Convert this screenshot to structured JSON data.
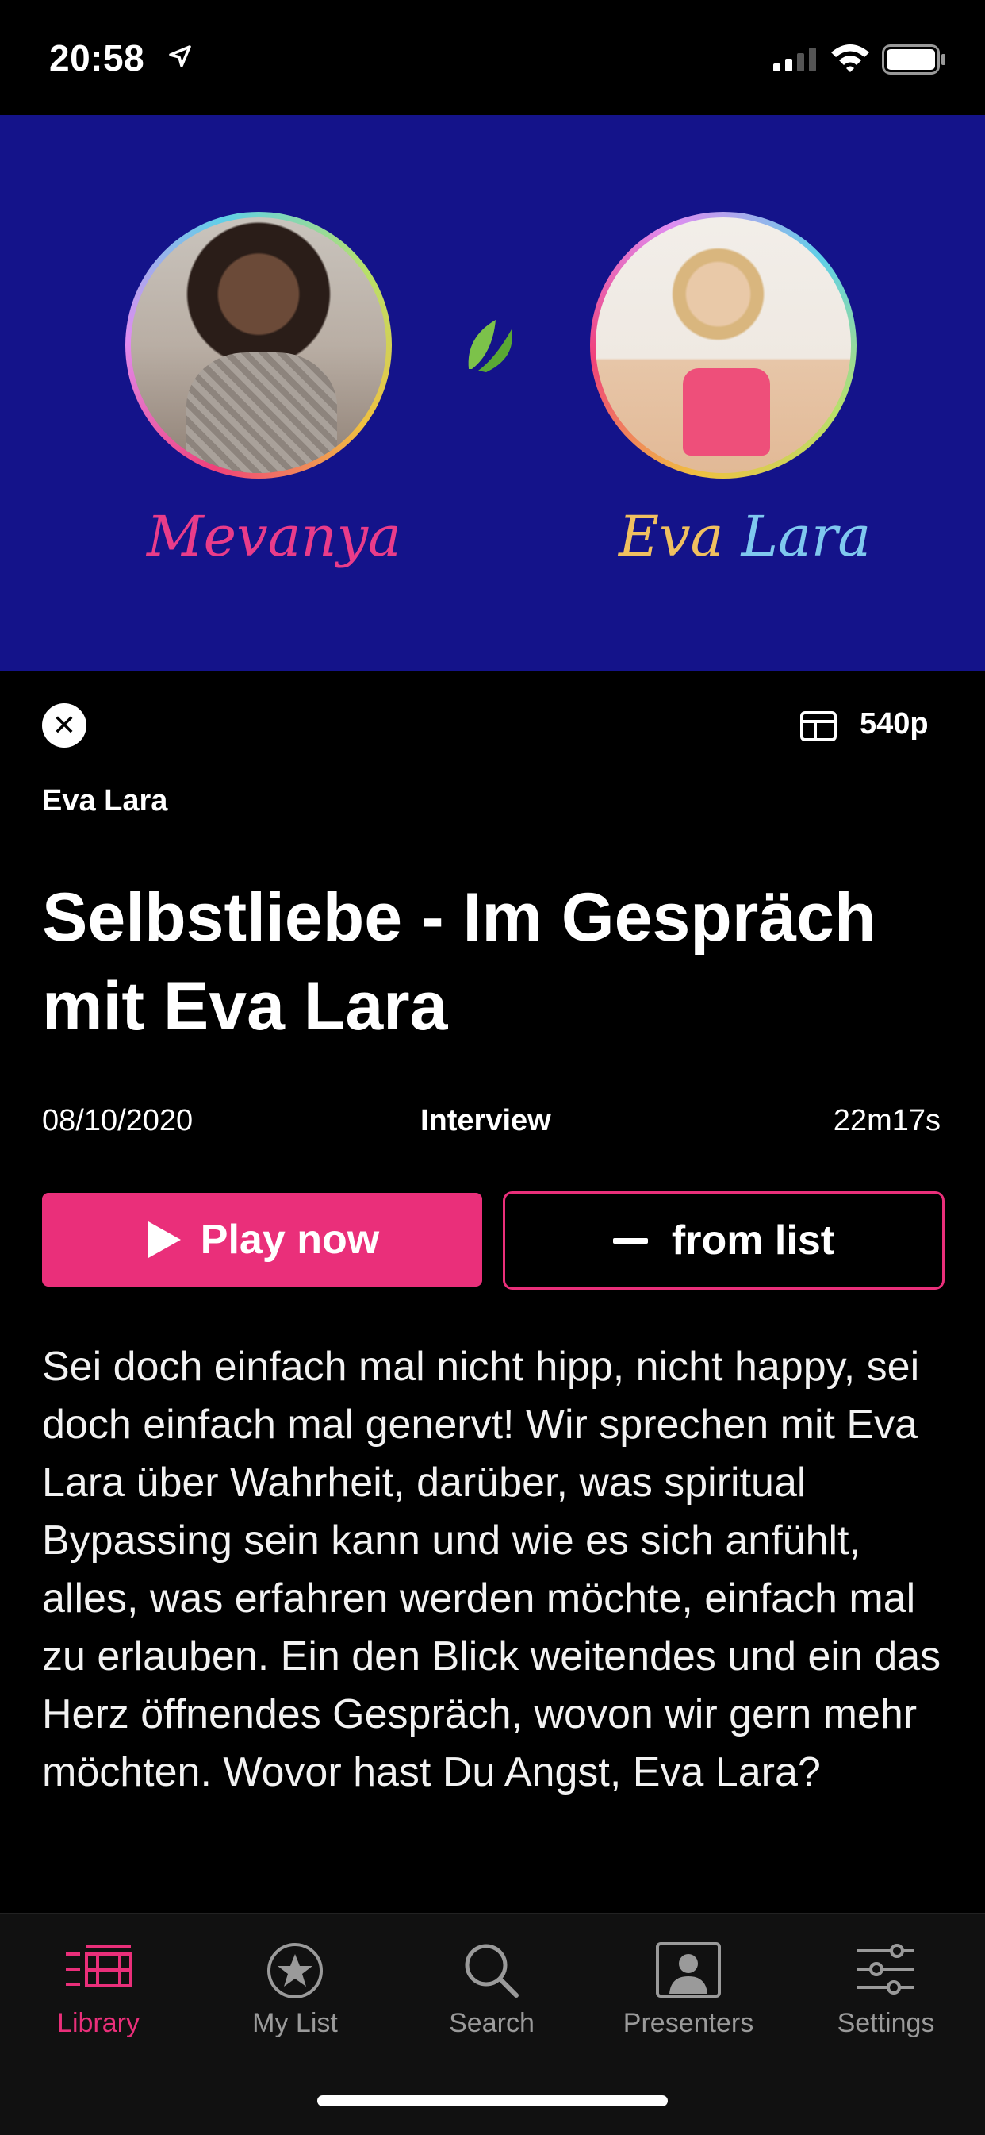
{
  "status_bar": {
    "time": "20:58"
  },
  "hero": {
    "left_signature": "Mevanya",
    "right_signature_first": "Eva ",
    "right_signature_last": "Lara"
  },
  "player": {
    "quality": "540p"
  },
  "episode": {
    "presenter": "Eva Lara",
    "title": "Selbstliebe - Im Gespräch mit Eva Lara",
    "date": "08/10/2020",
    "type": "Interview",
    "duration": "22m17s",
    "description": "Sei doch einfach mal nicht hipp, nicht happy, sei doch einfach mal genervt! Wir sprechen mit Eva Lara über Wahrheit, darüber, was spiritual Bypassing sein kann und wie es sich anfühlt, alles, was erfahren werden möchte, einfach mal zu erlauben. Ein den Blick weitendes und ein das Herz öffnendes Gespräch, wovon wir gern mehr möchten. Wovor hast Du Angst, Eva Lara?"
  },
  "actions": {
    "play_label": "Play now",
    "list_label": "from list"
  },
  "tabs": [
    {
      "label": "Library",
      "icon": "library-icon",
      "active": true
    },
    {
      "label": "My List",
      "icon": "star-circle-icon",
      "active": false
    },
    {
      "label": "Search",
      "icon": "search-icon",
      "active": false
    },
    {
      "label": "Presenters",
      "icon": "presenter-icon",
      "active": false
    },
    {
      "label": "Settings",
      "icon": "sliders-icon",
      "active": false
    }
  ],
  "colors": {
    "accent": "#ea2f7a",
    "hero_bg": "#14138a",
    "background": "#000000"
  }
}
